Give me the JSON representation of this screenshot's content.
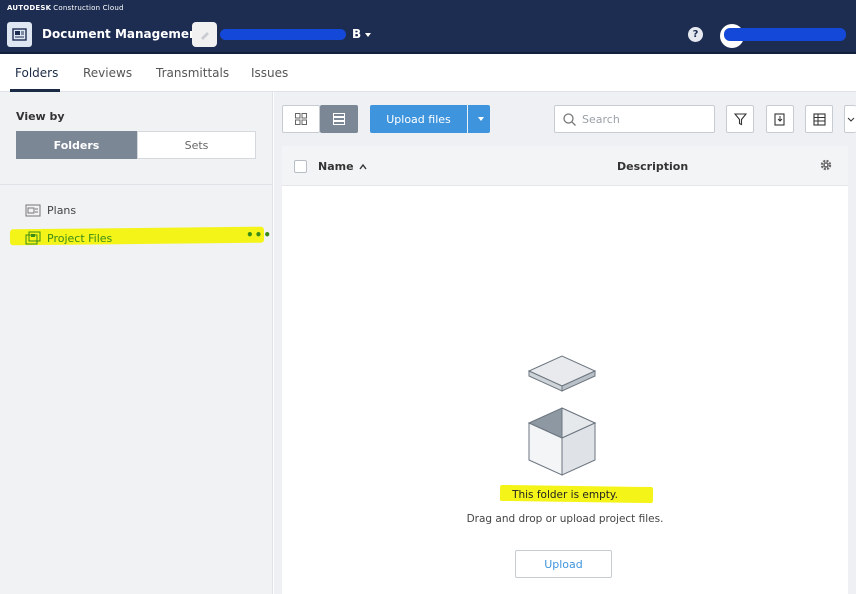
{
  "header": {
    "brand": "AUTODESK",
    "brand_sub": "Construction Cloud",
    "app_title": "Document Management",
    "project_suffix": "B",
    "help_label": "?"
  },
  "tabs": [
    {
      "label": "Folders",
      "active": true
    },
    {
      "label": "Reviews"
    },
    {
      "label": "Transmittals"
    },
    {
      "label": "Issues"
    }
  ],
  "sidebar": {
    "view_by_label": "View by",
    "segments": [
      "Folders",
      "Sets"
    ],
    "tree": [
      {
        "label": "Plans",
        "icon": "plans-folder-icon"
      },
      {
        "label": "Project Files",
        "icon": "project-files-folder-icon",
        "more": "•••"
      }
    ]
  },
  "toolbar": {
    "upload_files_label": "Upload files",
    "search_placeholder": "Search"
  },
  "table": {
    "columns": [
      "Name",
      "Description"
    ],
    "empty_title": "This folder is empty.",
    "empty_subtitle": "Drag and drop or upload project files.",
    "upload_label": "Upload"
  },
  "colors": {
    "header_bg": "#1d2d52",
    "accent_blue": "#3f95dd",
    "highlight": "#f4f418",
    "selected_tree": "#3a8b17"
  }
}
